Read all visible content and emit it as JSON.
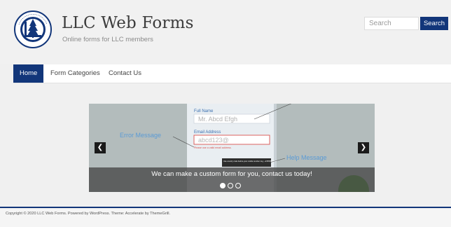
{
  "site": {
    "title": "LLC Web Forms",
    "description": "Online forms for LLC members",
    "logo_text": "LAKELAND LIBRARY COOPERATIVE"
  },
  "search": {
    "placeholder": "Search",
    "button_label": "Search"
  },
  "nav": {
    "items": [
      {
        "label": "Home",
        "active": true
      },
      {
        "label": "Form Categories",
        "active": false
      },
      {
        "label": "Contact Us",
        "active": false
      }
    ]
  },
  "slider": {
    "caption": "We can make a custom form for you, contact us today!",
    "prev_icon": "chevron-left-icon",
    "next_icon": "chevron-right-icon",
    "slide_count": 3,
    "active_slide": 1,
    "image": {
      "full_name_label": "Full Name",
      "full_name_value": "Mr. Abcd Efgh",
      "email_label": "Email Address",
      "email_value": "abcd123@",
      "error_text": "Please use a valid email address.",
      "error_callout": "Error Message",
      "help_callout": "Help Message",
      "tooltip_text": "Use country code before your mobile number. E.g. +15555555678"
    }
  },
  "footer": {
    "copyright": "Copyright © 2020 LLC Web Forms. Powered by WordPress. Theme: Accelerate by ThemeGrill."
  },
  "colors": {
    "accent": "#12367a",
    "background": "#f0f0f0",
    "callout_blue": "#5b9bd5",
    "error_red": "#d9534f"
  }
}
